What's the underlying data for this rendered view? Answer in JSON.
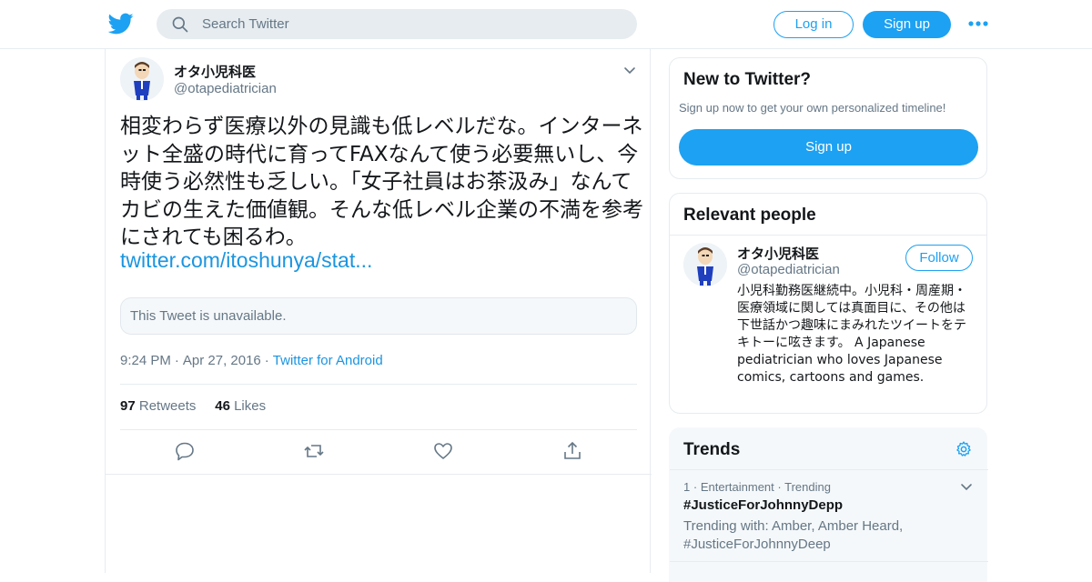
{
  "header": {
    "search_placeholder": "Search Twitter",
    "login_label": "Log in",
    "signup_label": "Sign up",
    "icons": [
      "twitter-bird-icon",
      "search-icon",
      "more-dots-icon"
    ],
    "brand_color": "#1da1f2"
  },
  "tweet": {
    "author_name": "オタ小児科医",
    "author_handle": "@otapediatrician",
    "text": "相変わらず医療以外の見識も低レベルだな。インターネット全盛の時代に育ってFAXなんて使う必要無いし、今時使う必然性も乏しい。「女子社員はお茶汲み」なんてカビの生えた価値観。そんな低レベル企業の不満を参考にされても困るわ。",
    "link": "twitter.com/itoshunya/stat...",
    "quoted_unavailable": "This Tweet is unavailable.",
    "time": "9:24 PM",
    "date": "Apr 27, 2016",
    "source": "Twitter for Android",
    "dot": "·",
    "retweets_count": "97",
    "retweets_label": "Retweets",
    "likes_count": "46",
    "likes_label": "Likes"
  },
  "new_to_twitter": {
    "title": "New to Twitter?",
    "subtitle": "Sign up now to get your own personalized timeline!",
    "button": "Sign up"
  },
  "relevant_people": {
    "title": "Relevant people",
    "name": "オタ小児科医",
    "handle": "@otapediatrician",
    "follow_label": "Follow",
    "bio": "小児科勤務医継続中。小児科・周産期・医療領域に関しては真面目に、その他は下世話かつ趣味にまみれたツイートをテキトーに呟きます。 A Japanese pediatrician who loves Japanese comics, cartoons and games."
  },
  "trends": {
    "title": "Trends",
    "items": [
      {
        "rank": "1",
        "category": "Entertainment",
        "kind": "Trending",
        "tag": "#JusticeForJohnnyDepp",
        "with": "Trending with: Amber, Amber Heard, #JusticeForJohnnyDeep"
      }
    ]
  }
}
